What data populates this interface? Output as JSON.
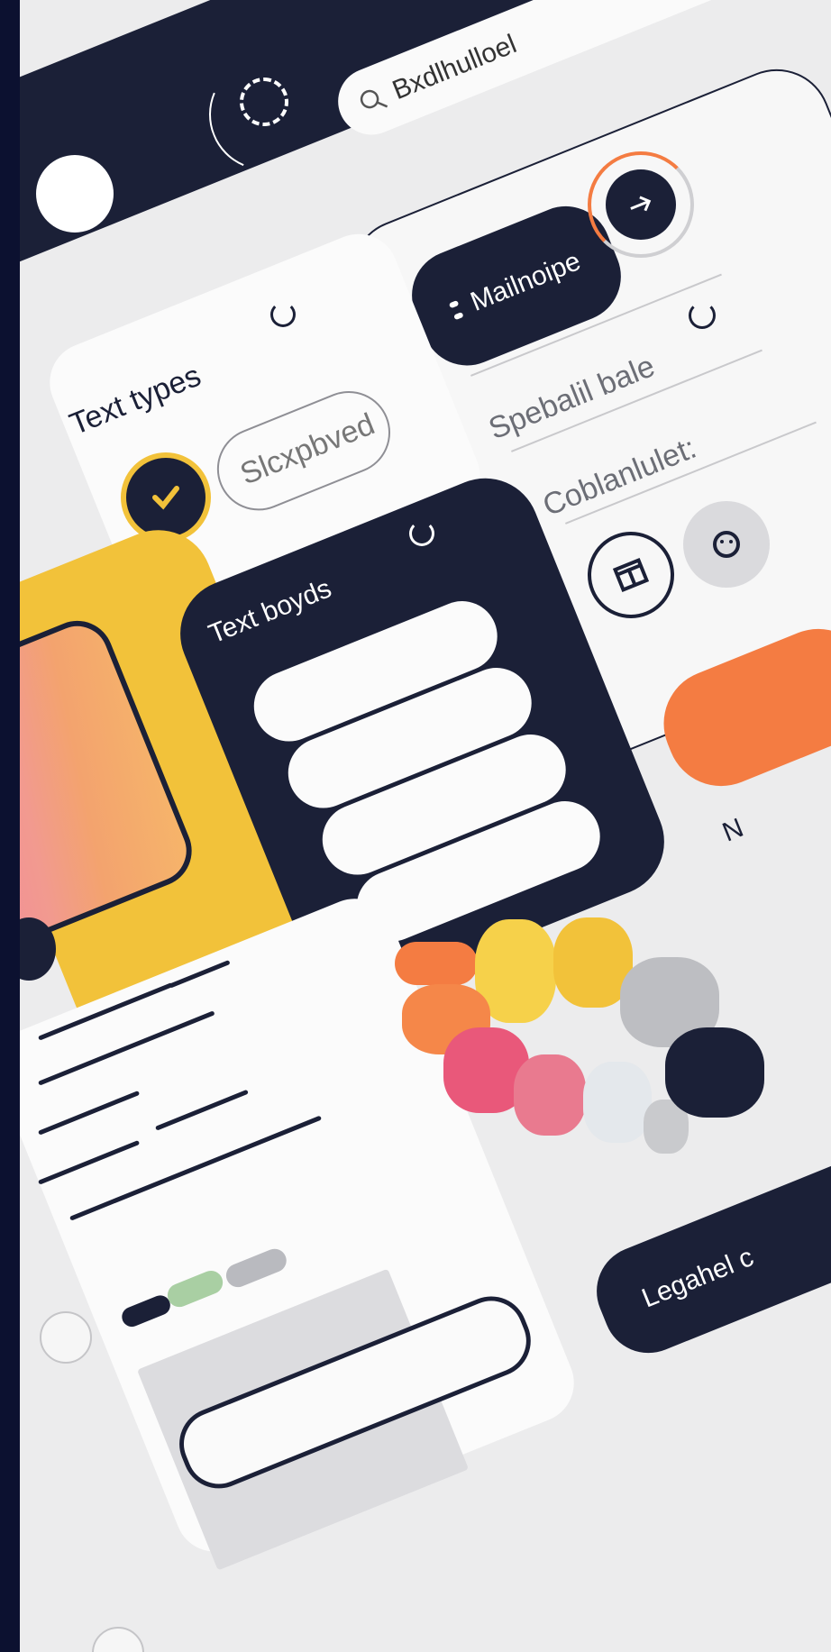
{
  "topbar": {
    "search_text": "Bxdlhulloel"
  },
  "card_text_types": {
    "title": "Text types",
    "chip_label": "Slcxpbved"
  },
  "card_text_boxes": {
    "title": "Text boyds"
  },
  "card_menu": {
    "button_label": "Mailnoipe",
    "item1": "Spebalil bale",
    "item2": "Coblanlulet:"
  },
  "partial_letter": "N",
  "bottom_button": "Legahel c",
  "colors": {
    "dark": "#1b2037",
    "yellow": "#f2c23a",
    "orange": "#f47c42",
    "pink": "#e9587a",
    "gray": "#bdbec2",
    "light": "#e4e8ec"
  }
}
